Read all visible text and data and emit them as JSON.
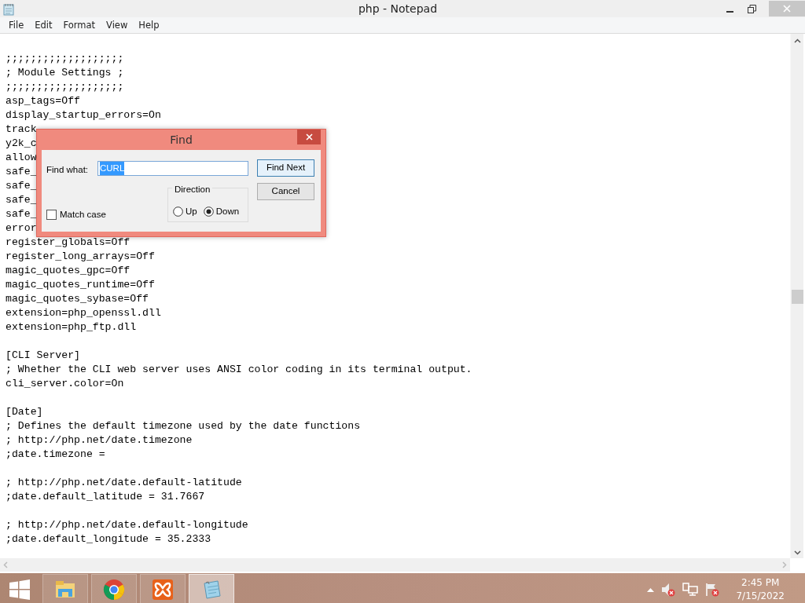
{
  "window": {
    "title": "php - Notepad"
  },
  "menu": [
    "File",
    "Edit",
    "Format",
    "View",
    "Help"
  ],
  "editor": {
    "blocks": [
      [
        ";;;;;;;;;;;;;;;;;;;",
        "; Module Settings ;",
        ";;;;;;;;;;;;;;;;;;;",
        "asp_tags=Off",
        "display_startup_errors=On",
        "track",
        "y2k_c",
        "allow",
        "safe_",
        "safe_",
        "safe_",
        "safe_",
        "error",
        "register_globals=Off",
        "register_long_arrays=Off",
        "magic_quotes_gpc=Off",
        "magic_quotes_runtime=Off",
        "magic_quotes_sybase=Off",
        "extension=php_openssl.dll",
        "extension=php_ftp.dll"
      ],
      [
        "[CLI Server]",
        "; Whether the CLI web server uses ANSI color coding in its terminal output.",
        "cli_server.color=On"
      ],
      [
        "[Date]",
        "; Defines the default timezone used by the date functions",
        "; http://php.net/date.timezone",
        ";date.timezone ="
      ],
      [
        "; http://php.net/date.default-latitude",
        ";date.default_latitude = 31.7667"
      ],
      [
        "; http://php.net/date.default-longitude",
        ";date.default_longitude = 35.2333"
      ]
    ]
  },
  "find_dialog": {
    "title": "Find",
    "find_what_label": "Find what:",
    "find_what_value": "CURL",
    "value_selected": true,
    "find_next": "Find Next",
    "cancel": "Cancel",
    "direction_label": "Direction",
    "directions": [
      {
        "label": "Up",
        "selected": false
      },
      {
        "label": "Down",
        "selected": true
      }
    ],
    "match_case": {
      "label": "Match case",
      "checked": false
    }
  },
  "taskbar": {
    "apps": [
      {
        "kind": "explorer",
        "active": false
      },
      {
        "kind": "chrome",
        "active": false
      },
      {
        "kind": "xampp",
        "active": false
      },
      {
        "kind": "notepad",
        "active": true
      }
    ],
    "clock": {
      "time": "2:45 PM",
      "date": "7/15/2022"
    }
  }
}
